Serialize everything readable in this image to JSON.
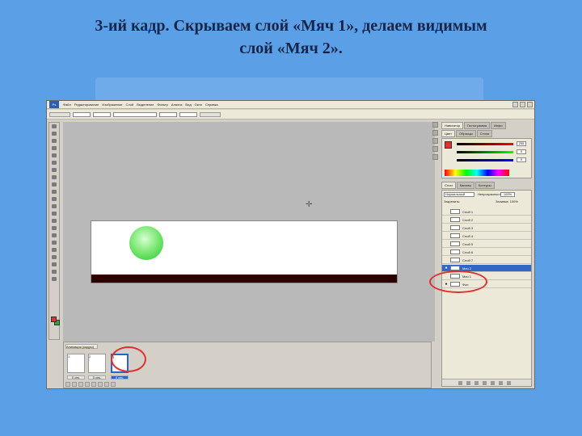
{
  "slide": {
    "title_line1": "3-ий кадр. Скрываем слой «Мяч 1», делаем видимым",
    "title_line2": "слой «Мяч 2»."
  },
  "app": {
    "logo": "Ps",
    "menu": [
      "Файл",
      "Редактирование",
      "Изображение",
      "Слой",
      "Выделение",
      "Фильтр",
      "Анализ",
      "Вид",
      "Окно",
      "Справка"
    ],
    "panel_tabs_top": [
      "Навигатор",
      "Гистограмма",
      "Инфо"
    ],
    "panel_tabs_color": [
      "Цвет",
      "Образцы",
      "Стили"
    ],
    "panel_tabs_layers": [
      "Слои",
      "Каналы",
      "Контуры"
    ],
    "color_values": [
      "255",
      "0",
      "0"
    ],
    "layers": {
      "blend_mode": "Нормальный",
      "opacity_label": "Непрозрачность:",
      "opacity_value": "100%",
      "lock_label": "Закрепить:",
      "fill_label": "Заливка: 100%",
      "rows": [
        {
          "name": "Слой 1",
          "visible": false,
          "selected": false
        },
        {
          "name": "Слой 2",
          "visible": false,
          "selected": false
        },
        {
          "name": "Слой 3",
          "visible": false,
          "selected": false
        },
        {
          "name": "Слой 4",
          "visible": false,
          "selected": false
        },
        {
          "name": "Слой 5",
          "visible": false,
          "selected": false
        },
        {
          "name": "Слой 6",
          "visible": false,
          "selected": false
        },
        {
          "name": "Слой 7",
          "visible": false,
          "selected": false
        },
        {
          "name": "Мяч 2",
          "visible": true,
          "selected": true
        },
        {
          "name": "Мяч 1",
          "visible": false,
          "selected": false
        },
        {
          "name": "Фон",
          "visible": true,
          "selected": false
        }
      ]
    },
    "animation": {
      "title": "Анимация (кадры)",
      "frames": [
        {
          "num": "1",
          "delay": "0 сек."
        },
        {
          "num": "2",
          "delay": "0 сек."
        },
        {
          "num": "3",
          "delay": "0 сек."
        }
      ],
      "loop": "Однократно"
    }
  },
  "colors": {
    "background": "#5b9fe6",
    "ball": "#4fd64b",
    "highlight_ring": "#e03030",
    "selection": "#3168c6",
    "floor": "#2a0000"
  }
}
